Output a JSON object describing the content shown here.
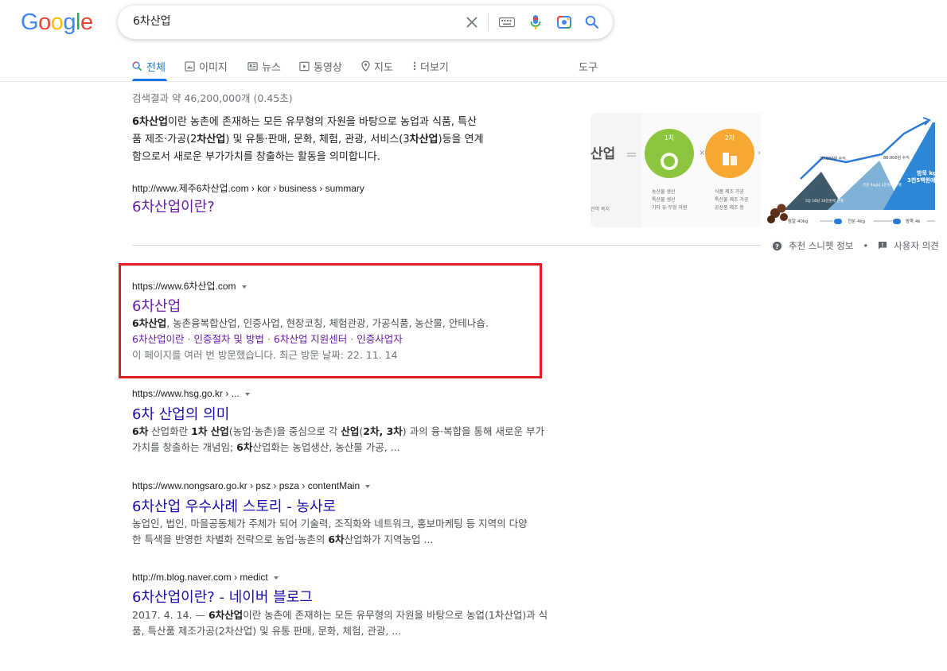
{
  "logo": {
    "letters": [
      "G",
      "o",
      "o",
      "g",
      "l",
      "e"
    ],
    "colors": [
      "#4285f4",
      "#ea4335",
      "#fbbc05",
      "#4285f4",
      "#34a853",
      "#ea4335"
    ]
  },
  "search": {
    "query": "6차산업"
  },
  "tabs": [
    {
      "label": "전체",
      "icon": "search-icon",
      "active": true
    },
    {
      "label": "이미지",
      "icon": "image-icon"
    },
    {
      "label": "뉴스",
      "icon": "news-icon"
    },
    {
      "label": "동영상",
      "icon": "video-icon"
    },
    {
      "label": "지도",
      "icon": "map-pin-icon"
    },
    {
      "label": "더보기",
      "icon": "more-vert-icon"
    }
  ],
  "tools_label": "도구",
  "result_stats": "검색결과 약 46,200,000개 (0.45초)",
  "featured_snippet": {
    "lines": [
      [
        "6차산업",
        "이란 농촌에 존재하는 모든 유무형의 자원을 바탕으로 농업과 식품, 특산"
      ],
      [
        "품 제조·가공(2",
        "차산업",
        ") 및 유통·판매, 문화, 체험, 관광, 서비스(3",
        "차산업",
        ")등을 연계"
      ],
      [
        "함으로서 새로운 부가가치를 창출하는 활동을 의미합니다."
      ]
    ],
    "url": "http://www.제주6차산업.com › kor › business › summary",
    "title": "6차산업이란?"
  },
  "image1": {
    "label": "산업",
    "circle1": "1차",
    "circle2": "2차",
    "left_caption": "관역 복지",
    "caption1": [
      "농산물 생산",
      "특산물 생산",
      "기타 유·무형 자원"
    ],
    "caption2": [
      "식품 제조 가공",
      "특산물 제조 가공",
      "공산품 제조 등"
    ]
  },
  "image2": {
    "labels": [
      "20,000원 수익",
      "80,000원 수익",
      "5등 16담 16만원에 판매",
      "전분 4kg담 2만원에 판매",
      "밤묵 kg",
      "3천5백원에"
    ],
    "bottom": [
      "밤알 40kg",
      "전분 4kg",
      "밤묵 4k"
    ],
    "badge": "가공"
  },
  "snippet_footer": {
    "about": "추천 스니펫 정보",
    "feedback": "사용자 의견"
  },
  "results": [
    {
      "url": "https://www.6차산업.com",
      "title": "6차산업",
      "desc_bold": "6차산업",
      "desc": ", 농촌융복합산업, 인증사업, 현장코칭, 체험관광, 가공식품, 농산물, 안테나숍.",
      "sitelinks": [
        "6차산업이란",
        "인증절차 및 방법",
        "6차산업 지원센터",
        "인증사업자"
      ],
      "visited": "이 페이지를 여러 번 방문했습니다. 최근 방문 날짜: 22. 11. 14"
    },
    {
      "url": "https://www.hsg.go.kr › ...",
      "title": "6차 산업의 의미",
      "desc_line1": [
        [
          "6차",
          true
        ],
        [
          " 산업화란 ",
          false
        ],
        [
          "1차 산업",
          true
        ],
        [
          "(농업·농촌)을 중심으로 각 ",
          false
        ],
        [
          "산업",
          true
        ],
        [
          "(",
          false
        ],
        [
          "2차, 3차",
          true
        ],
        [
          ") 과의 융·복합을 통해 새로운 부가",
          false
        ]
      ],
      "desc_line2": [
        [
          "가치를 창출하는 개념임; ",
          false
        ],
        [
          "6차",
          true
        ],
        [
          "산업화는 농업생산, 농산물 가공, ...",
          false
        ]
      ]
    },
    {
      "url": "https://www.nongsaro.go.kr › psz › psza › contentMain",
      "title": "6차산업 우수사례 스토리 - 농사로",
      "desc_line1": [
        [
          "농업인, 법인, 마을공동체가 주체가 되어 기술력, 조직화와 네트워크, 홍보마케팅 등 지역의 다양",
          false
        ]
      ],
      "desc_line2": [
        [
          "한 특색을 반영한 차별화 전략으로 농업·농촌의 ",
          false
        ],
        [
          "6차",
          true
        ],
        [
          "산업화가 지역농업 ...",
          false
        ]
      ]
    },
    {
      "url": "http://m.blog.naver.com › medict",
      "title": "6차산업이란? - 네이버 블로그",
      "desc_line1": [
        [
          "2017. 4. 14. — ",
          false
        ],
        [
          "6차산업",
          true
        ],
        [
          "이란 농촌에 존재하는 모든 유무형의 자원을 바탕으로 농업(1차산업)과 식",
          false
        ]
      ],
      "desc_line2": [
        [
          "품, 특산품 제조가공(2차산업) 및 유통 판매, 문화, 체험, 관광, ...",
          false
        ]
      ]
    }
  ]
}
